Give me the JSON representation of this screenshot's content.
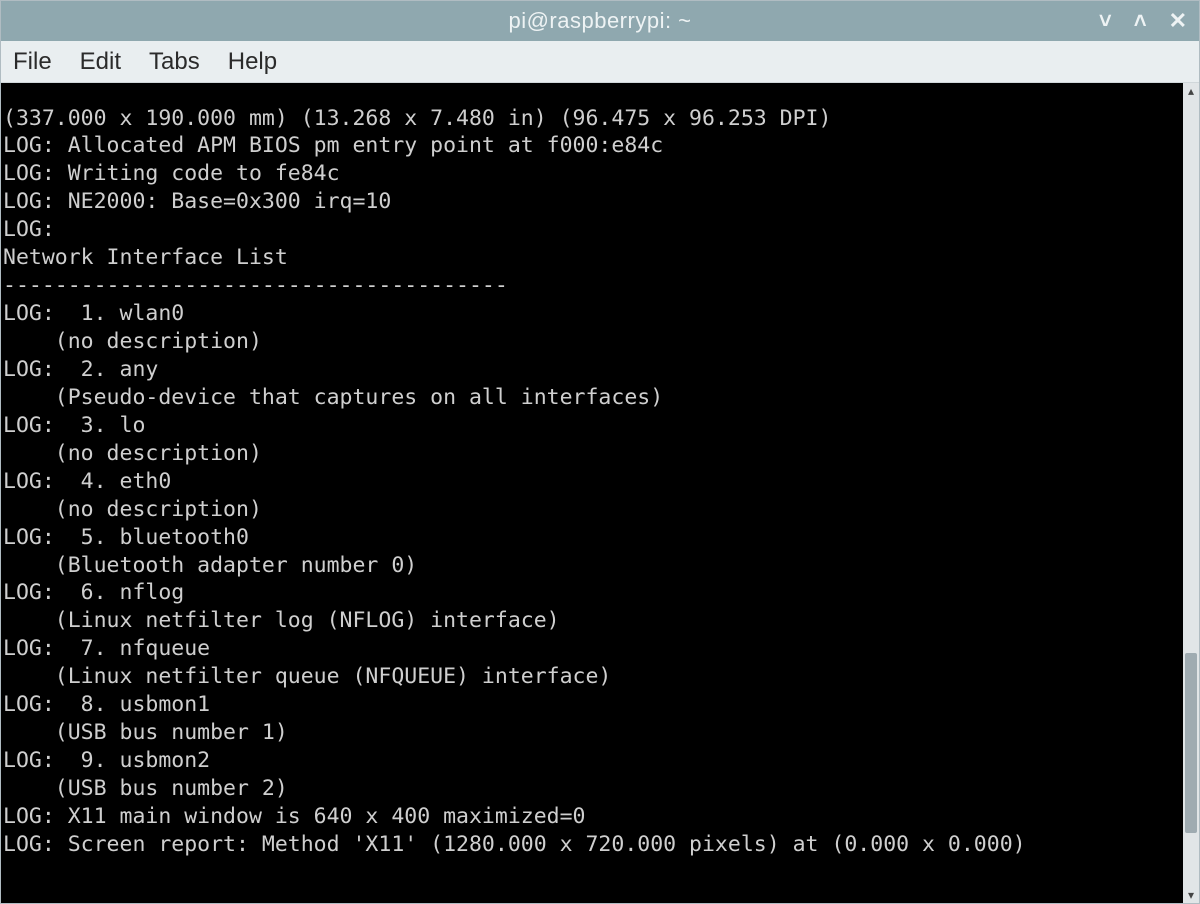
{
  "window": {
    "title": "pi@raspberrypi: ~"
  },
  "menu": {
    "file": "File",
    "edit": "Edit",
    "tabs": "Tabs",
    "help": "Help"
  },
  "controls": {
    "minimize": "˅",
    "maximize": "˄",
    "close": "✕"
  },
  "scroll": {
    "up": "▴",
    "down": "▾"
  },
  "terminal_text": "(337.000 x 190.000 mm) (13.268 x 7.480 in) (96.475 x 96.253 DPI)\nLOG: Allocated APM BIOS pm entry point at f000:e84c\nLOG: Writing code to fe84c\nLOG: NE2000: Base=0x300 irq=10\nLOG:\nNetwork Interface List\n---------------------------------------\nLOG:  1. wlan0\n    (no description)\nLOG:  2. any\n    (Pseudo-device that captures on all interfaces)\nLOG:  3. lo\n    (no description)\nLOG:  4. eth0\n    (no description)\nLOG:  5. bluetooth0\n    (Bluetooth adapter number 0)\nLOG:  6. nflog\n    (Linux netfilter log (NFLOG) interface)\nLOG:  7. nfqueue\n    (Linux netfilter queue (NFQUEUE) interface)\nLOG:  8. usbmon1\n    (USB bus number 1)\nLOG:  9. usbmon2\n    (USB bus number 2)\nLOG: X11 main window is 640 x 400 maximized=0\nLOG: Screen report: Method 'X11' (1280.000 x 720.000 pixels) at (0.000 x 0.000)"
}
